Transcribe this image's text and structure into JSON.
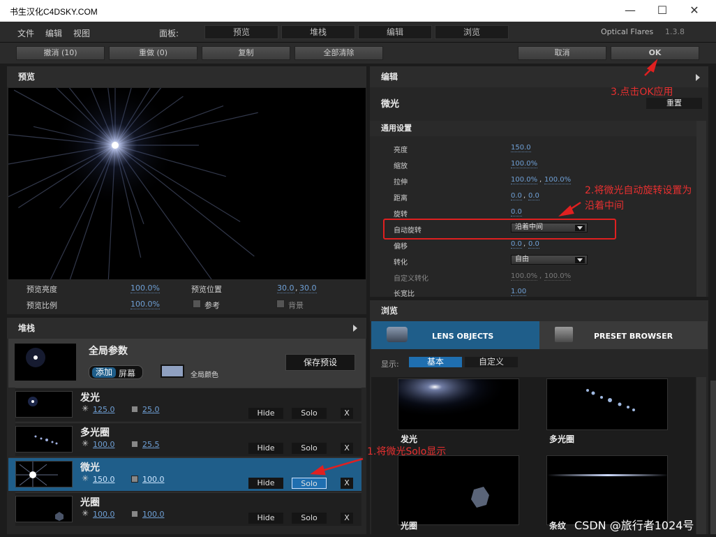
{
  "window": {
    "title": "书生汉化C4DSKY.COM",
    "minimize": "—",
    "maximize": "☐",
    "close": "✕"
  },
  "menubar": {
    "items": [
      "文件",
      "编辑",
      "视图"
    ],
    "panel_label": "面板:",
    "panel_tabs": [
      "预览",
      "堆栈",
      "编辑",
      "浏览"
    ],
    "app_name": "Optical Flares",
    "version": "1.3.8"
  },
  "toolbar": {
    "undo": "撤消 (10)",
    "redo": "重做 (0)",
    "copy": "复制",
    "clear_all": "全部清除",
    "cancel": "取消",
    "ok": "OK"
  },
  "preview": {
    "header": "预览",
    "brightness_label": "预览亮度",
    "brightness_value": "100.0%",
    "position_label": "预览位置",
    "position_x": "30.0",
    "position_y": "30.0",
    "scale_label": "预览比例",
    "scale_value": "100.0%",
    "reference_label": "参考",
    "background_label": "背景"
  },
  "stack": {
    "header": "堆栈",
    "global_title": "全局参数",
    "add_label": "添加",
    "screen_label": "屏幕",
    "global_color_label": "全局颜色",
    "save_preset": "保存预设",
    "layers": [
      {
        "name": "发光",
        "v1": "125.0",
        "v2": "25.0",
        "selected": false
      },
      {
        "name": "多光圈",
        "v1": "100.0",
        "v2": "25.5",
        "selected": false
      },
      {
        "name": "微光",
        "v1": "150.0",
        "v2": "100.0",
        "selected": true
      },
      {
        "name": "光圈",
        "v1": "100.0",
        "v2": "100.0",
        "selected": false
      }
    ],
    "hide_label": "Hide",
    "solo_label": "Solo",
    "remove_label": "X"
  },
  "edit": {
    "header": "编辑",
    "object_name": "微光",
    "reset": "重置",
    "section": "通用设置",
    "rows": {
      "brightness": {
        "label": "亮度",
        "value": "150.0"
      },
      "scale": {
        "label": "缩放",
        "value": "100.0%"
      },
      "stretch": {
        "label": "拉伸",
        "v1": "100.0%",
        "v2": "100.0%"
      },
      "distance": {
        "label": "距离",
        "v1": "0.0",
        "v2": "0.0"
      },
      "rotation": {
        "label": "旋转",
        "value": "0.0"
      },
      "autorotate": {
        "label": "自动旋转",
        "value": "沿着中间"
      },
      "offset": {
        "label": "偏移",
        "v1": "0.0",
        "v2": "0.0"
      },
      "transform": {
        "label": "转化",
        "value": "自由"
      },
      "custom_transform": {
        "label": "自定义转化",
        "v1": "100.0%",
        "v2": "100.0%"
      },
      "aspect": {
        "label": "长宽比",
        "value": "1.00"
      }
    }
  },
  "browse": {
    "header": "浏览",
    "tab_lens": "LENS OBJECTS",
    "tab_preset": "PRESET BROWSER",
    "display_label": "显示:",
    "filter_basic": "基本",
    "filter_custom": "自定义",
    "objects": [
      "发光",
      "多光圈",
      "光圈",
      "条纹"
    ]
  },
  "annotations": {
    "step1": "1.将微光Solo显示",
    "step2_line1": "2.将微光自动旋转设置为",
    "step2_line2": "沿着中间",
    "step3": "3.点击OK应用"
  },
  "watermark": "CSDN @旅行者1024号",
  "colors": {
    "accent": "#1f5e8a",
    "value_blue": "#6fa0d6",
    "annotation_red": "#e83030"
  }
}
